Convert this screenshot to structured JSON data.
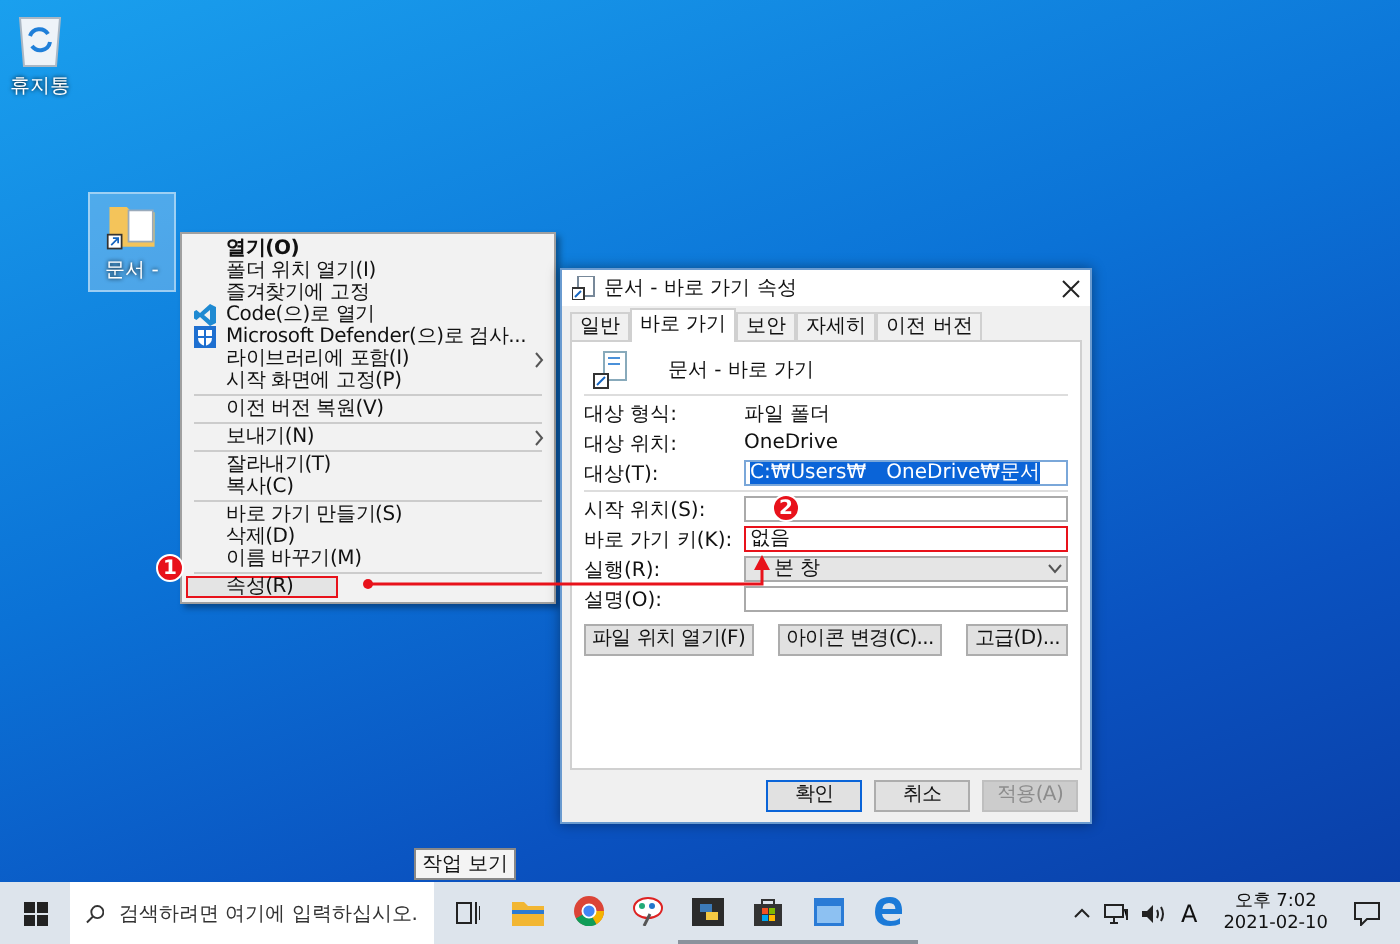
{
  "desktop_icons": [
    {
      "label": "휴지통"
    },
    {
      "label": "문서 -"
    }
  ],
  "context_menu": {
    "groups": [
      [
        {
          "label": "열기(O)",
          "kind": "plain",
          "default": true,
          "submenu": false,
          "highlighted": false
        },
        {
          "label": "폴더 위치 열기(I)",
          "kind": "plain",
          "default": false,
          "submenu": false,
          "highlighted": false
        },
        {
          "label": "즐겨찾기에 고정",
          "kind": "plain",
          "default": false,
          "submenu": false,
          "highlighted": false
        },
        {
          "label": "Code(으)로 열기",
          "kind": "app",
          "default": false,
          "submenu": false,
          "highlighted": false
        },
        {
          "label": "Microsoft Defender(으)로 검사...",
          "kind": "app",
          "default": false,
          "submenu": false,
          "highlighted": false
        },
        {
          "label": "라이브러리에 포함(I)",
          "kind": "plain",
          "default": false,
          "submenu": true,
          "highlighted": false
        },
        {
          "label": "시작 화면에 고정(P)",
          "kind": "plain",
          "default": false,
          "submenu": false,
          "highlighted": false
        }
      ],
      [
        {
          "label": "이전 버전 복원(V)",
          "kind": "plain",
          "default": false,
          "submenu": false,
          "highlighted": false
        }
      ],
      [
        {
          "label": "보내기(N)",
          "kind": "plain",
          "default": false,
          "submenu": true,
          "highlighted": false
        }
      ],
      [
        {
          "label": "잘라내기(T)",
          "kind": "plain",
          "default": false,
          "submenu": false,
          "highlighted": false
        },
        {
          "label": "복사(C)",
          "kind": "plain",
          "default": false,
          "submenu": false,
          "highlighted": false
        }
      ],
      [
        {
          "label": "바로 가기 만들기(S)",
          "kind": "plain",
          "default": false,
          "submenu": false,
          "highlighted": false
        },
        {
          "label": "삭제(D)",
          "kind": "plain",
          "default": false,
          "submenu": false,
          "highlighted": false
        },
        {
          "label": "이름 바꾸기(M)",
          "kind": "plain",
          "default": false,
          "submenu": false,
          "highlighted": false
        }
      ],
      [
        {
          "label": "속성(R)",
          "kind": "plain",
          "default": false,
          "submenu": false,
          "highlighted": true
        }
      ]
    ]
  },
  "callouts": [
    {
      "number": "1"
    },
    {
      "number": "2"
    }
  ],
  "dialog": {
    "title": "문서 - 바로 가기 속성",
    "tabs": [
      {
        "label": "일반",
        "selected": false
      },
      {
        "label": "바로 가기",
        "selected": true
      },
      {
        "label": "보안",
        "selected": false
      },
      {
        "label": "자세히",
        "selected": false
      },
      {
        "label": "이전 버전",
        "selected": false
      }
    ],
    "name": "문서 - 바로 가기",
    "info_rows": [
      {
        "label": "대상 형식:",
        "value": "파일 폴더"
      },
      {
        "label": "대상 위치:",
        "value": "OneDrive"
      }
    ],
    "target": {
      "label": "대상(T):",
      "value_start": "C:₩Users₩",
      "value_end": "OneDrive₩문서"
    },
    "fields": [
      {
        "label": "시작 위치(S):",
        "kind": "text",
        "highlighted": false
      },
      {
        "label": "바로 가기 키(K):",
        "kind": "text",
        "value": "없음",
        "highlighted": true
      },
      {
        "label": "실행(R):",
        "kind": "dropdown",
        "value": "본 창",
        "highlighted": false
      },
      {
        "label": "설명(O):",
        "kind": "text",
        "highlighted": false
      }
    ],
    "action_buttons": [
      "파일 위치 열기(F)",
      "아이콘 변경(C)...",
      "고급(D)..."
    ],
    "footer_buttons": [
      {
        "label": "확인",
        "disabled": false,
        "default": true
      },
      {
        "label": "취소",
        "disabled": false,
        "default": false
      },
      {
        "label": "적용(A)",
        "disabled": true,
        "default": false
      }
    ]
  },
  "taskbar": {
    "search_placeholder": "검색하려면 여기에 입력하십시오.",
    "tooltip": "작업 보기",
    "apps": [
      {
        "running": false
      },
      {
        "running": false
      },
      {
        "running": false
      },
      {
        "running": true
      },
      {
        "running": true
      },
      {
        "running": true
      },
      {
        "running": true
      }
    ],
    "ime": "A",
    "time": "오후 7:02",
    "date": "2021-02-10"
  }
}
